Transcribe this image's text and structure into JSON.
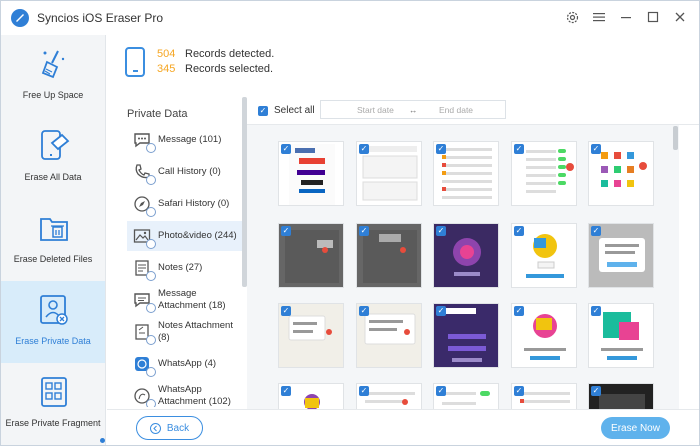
{
  "app": {
    "title": "Syncios iOS Eraser Pro"
  },
  "titlebar_icons": [
    "gear-icon",
    "menu-icon",
    "minimize-icon",
    "maximize-icon",
    "close-icon"
  ],
  "sidebar": {
    "items": [
      {
        "label": "Free Up Space",
        "icon": "broom-icon"
      },
      {
        "label": "Erase All Data",
        "icon": "phone-eraser-icon"
      },
      {
        "label": "Erase Deleted Files",
        "icon": "trash-folder-icon"
      },
      {
        "label": "Erase Private Data",
        "icon": "private-user-icon",
        "active": true
      },
      {
        "label": "Erase Private Fragment",
        "icon": "fragment-grid-icon"
      }
    ]
  },
  "summary": {
    "detected_count": "504",
    "detected_label": "Records detected.",
    "selected_count": "345",
    "selected_label": "Records selected."
  },
  "categories": {
    "title": "Private Data",
    "items": [
      {
        "label": "Message (101)",
        "icon": "message-icon"
      },
      {
        "label": "Call History (0)",
        "icon": "phone-icon"
      },
      {
        "label": "Safari History (0)",
        "icon": "safari-icon"
      },
      {
        "label": "Photo&video (244)",
        "icon": "photo-icon",
        "selected": true
      },
      {
        "label": "Notes (27)",
        "icon": "notes-icon"
      },
      {
        "label": "Message Attachment (18)",
        "icon": "message-attachment-icon"
      },
      {
        "label": "Notes Attachment (8)",
        "icon": "notes-attachment-icon"
      },
      {
        "label": "WhatsApp (4)",
        "icon": "whatsapp-icon"
      },
      {
        "label": "WhatsApp Attachment (102)",
        "icon": "whatsapp-attachment-icon"
      }
    ]
  },
  "toolbar": {
    "select_all": "Select all",
    "start_date": "Start date",
    "separator": "↔",
    "end_date": "End date"
  },
  "colors": {
    "accent": "#2f7fd6",
    "count": "#f5a623",
    "active_nav": "#d8ecfa",
    "erase_button": "#5fb2ec"
  },
  "footer": {
    "back": "Back",
    "erase": "Erase Now"
  }
}
